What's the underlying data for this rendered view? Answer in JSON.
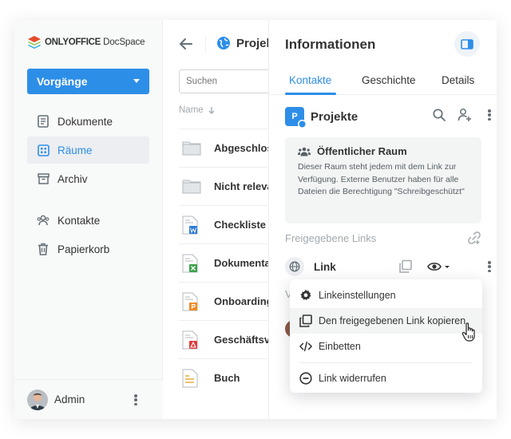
{
  "app": {
    "logo_brand": "ONLYOFFICE",
    "logo_product": "DocSpace"
  },
  "sidebar": {
    "main_button_label": "Vorgänge",
    "items": [
      {
        "label": "Dokumente",
        "icon": "document-icon",
        "active": false
      },
      {
        "label": "Räume",
        "icon": "rooms-grid-icon",
        "active": true
      },
      {
        "label": "Archiv",
        "icon": "archive-icon",
        "active": false
      },
      {
        "label": "Kontakte",
        "icon": "contacts-icon",
        "active": false
      },
      {
        "label": "Papierkorb",
        "icon": "trash-icon",
        "active": false
      }
    ],
    "user_name": "Admin"
  },
  "files": {
    "breadcrumb": "Projekte",
    "search_placeholder": "Suchen",
    "column_name": "Name",
    "rows": [
      {
        "name": "Abgeschlossen",
        "type": "folder"
      },
      {
        "name": "Nicht relevant",
        "type": "folder"
      },
      {
        "name": "Checkliste",
        "type": "docx"
      },
      {
        "name": "Dokumentation",
        "type": "xlsx"
      },
      {
        "name": "Onboarding",
        "type": "pptx"
      },
      {
        "name": "Geschäftsvorlagen",
        "type": "pdf"
      },
      {
        "name": "Buch",
        "type": "txt"
      }
    ]
  },
  "info": {
    "title": "Informationen",
    "tabs": [
      "Kontakte",
      "Geschichte",
      "Details"
    ],
    "active_tab": "Kontakte",
    "room_badge": "P",
    "room_name": "Projekte",
    "public_title": "Öffentlicher Raum",
    "public_desc": "Dieser Raum steht jedem mit dem Link zur Verfügung. Externe Benutzer haben für alle Dateien die Berechtigung \"Schreibgeschützt\"",
    "shared_links_label": "Freigegebene Links",
    "link_label": "Link",
    "obscured_label": "V"
  },
  "menu": {
    "items": [
      {
        "label": "Linkeinstellungen",
        "icon": "gear-icon"
      },
      {
        "label": "Den freigegebenen Link kopieren",
        "icon": "copy-icon"
      },
      {
        "label": "Einbetten",
        "icon": "embed-code-icon"
      },
      {
        "label": "Link widerrufen",
        "icon": "revoke-icon"
      }
    ],
    "hovered_index": 1
  },
  "colors": {
    "accent": "#2d8ee8",
    "sidebar_bg": "#f8f9f9",
    "docx": "#2b7bd5",
    "xlsx": "#3fa14d",
    "pptx": "#f08a24",
    "pdf": "#e23b3b",
    "txt": "#e3a82b"
  }
}
